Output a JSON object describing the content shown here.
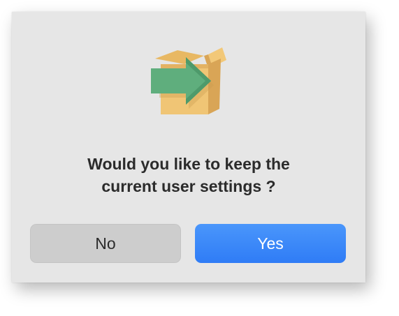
{
  "dialog": {
    "message_line1": "Would you like to keep the",
    "message_line2": "current user settings ?",
    "icon": "box-with-arrow-icon",
    "buttons": {
      "no_label": "No",
      "yes_label": "Yes"
    }
  },
  "colors": {
    "dialog_background": "#e6e6e6",
    "primary_button": "#3a86f9",
    "secondary_button": "#cdcdcd",
    "box_body": "#f0c575",
    "box_shade": "#d9a556",
    "arrow": "#5fae7d"
  }
}
